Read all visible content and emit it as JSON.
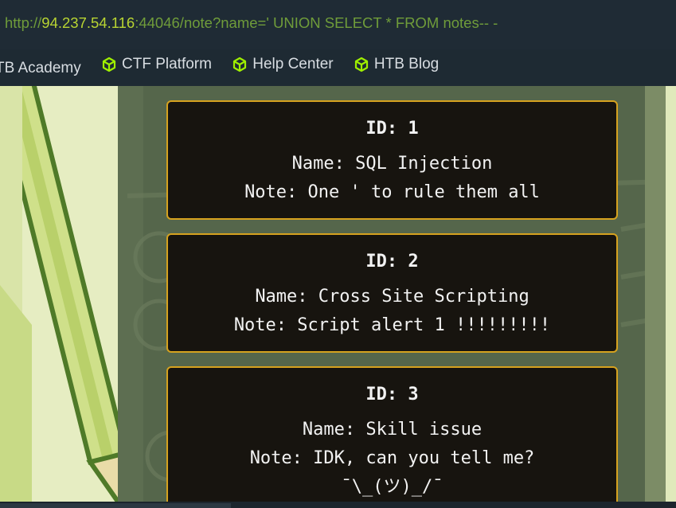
{
  "address_bar": {
    "scheme": "http://",
    "host": "94.237.54.116",
    "rest": ":44046/note?name=' UNION SELECT * FROM notes-- -"
  },
  "bookmarks": [
    {
      "label": "TB Academy",
      "icon": ""
    },
    {
      "label": "CTF Platform",
      "icon": "cube-icon"
    },
    {
      "label": "Help Center",
      "icon": "cube-icon"
    },
    {
      "label": "HTB Blog",
      "icon": "cube-icon"
    }
  ],
  "notes": [
    {
      "id": "ID: 1",
      "name": "Name: SQL Injection",
      "note": [
        "Note: One ' to rule them all"
      ]
    },
    {
      "id": "ID: 2",
      "name": "Name: Cross Site Scripting",
      "note": [
        "Note: Script alert 1 !!!!!!!!!"
      ]
    },
    {
      "id": "ID: 3",
      "name": "Name: Skill issue",
      "note": [
        "Note: IDK, can you tell me?",
        "¯\\_(ツ)_/¯"
      ]
    }
  ],
  "colors": {
    "accent_border": "#d6a21f",
    "url_host": "#b8d432",
    "url_text": "#6f9c3a",
    "icon_green": "#9fef00"
  }
}
